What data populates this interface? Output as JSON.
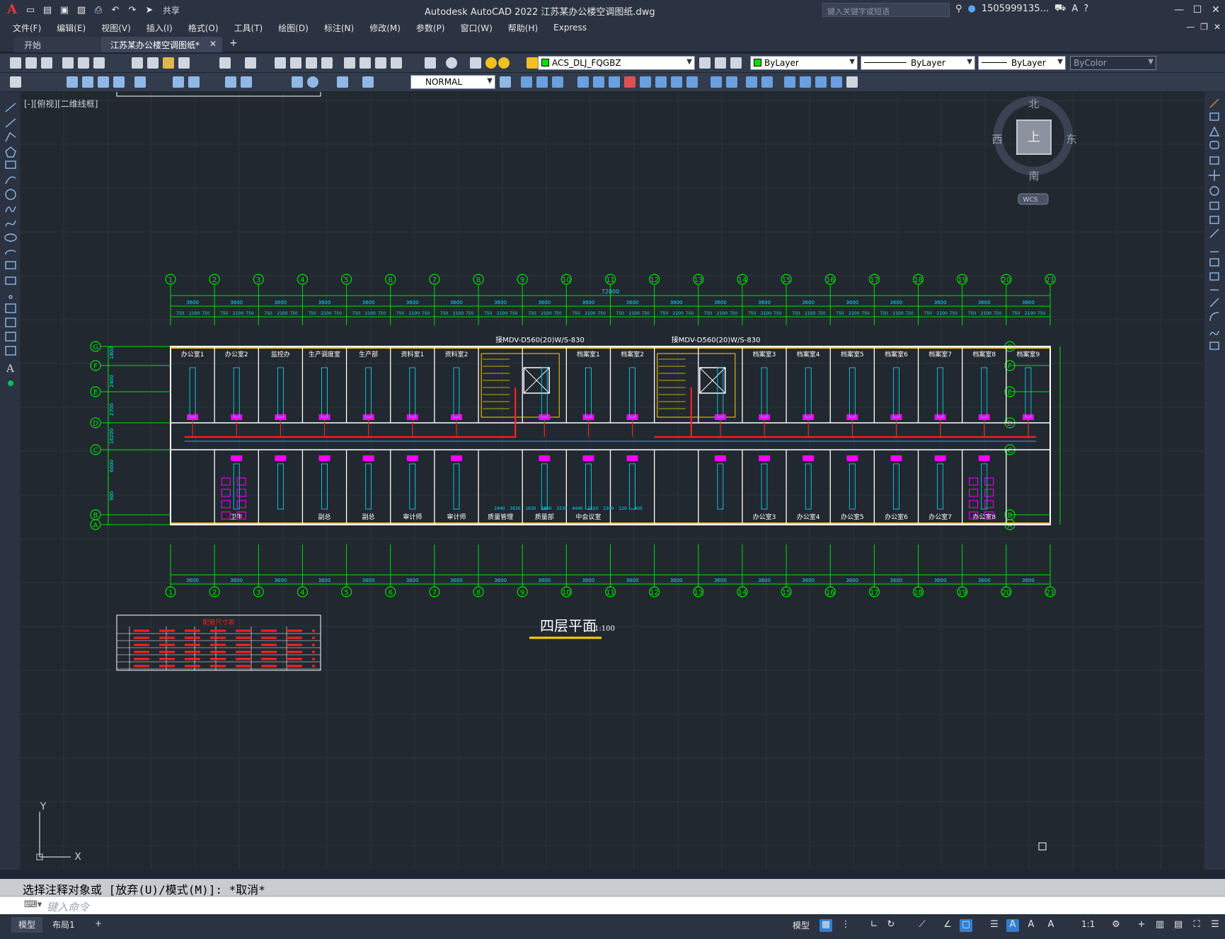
{
  "app": {
    "title": "Autodesk AutoCAD 2022    江苏某办公楼空调图纸.dwg",
    "share_label": "共享",
    "search_placeholder": "键入关键字或短语",
    "user": "1505999135...",
    "window_buttons": [
      "—",
      "☐",
      "✕"
    ]
  },
  "menu": [
    "文件(F)",
    "编辑(E)",
    "视图(V)",
    "插入(I)",
    "格式(O)",
    "工具(T)",
    "绘图(D)",
    "标注(N)",
    "修改(M)",
    "参数(P)",
    "窗口(W)",
    "帮助(H)",
    "Express"
  ],
  "tabs": {
    "start": "开始",
    "active": "江苏某办公楼空调图纸*",
    "close": "✕",
    "add": "+"
  },
  "toolbar": {
    "layer": "ACS_DLJ_FQGBZ",
    "color": "ByLayer",
    "linetype": "ByLayer",
    "lineweight": "ByLayer",
    "plotstyle": "ByColor",
    "dimstyle": "NORMAL"
  },
  "viewport_label": "[-][俯视][二维线框]",
  "viewcube": {
    "north": "北",
    "south": "南",
    "east": "东",
    "west": "西",
    "face": "上",
    "wcs": "WCS"
  },
  "ucs": {
    "x": "X",
    "y": "Y"
  },
  "drawing": {
    "title": "四层平面",
    "scale": "1:100",
    "total_dim": "72000",
    "table_title": "配管尺寸表",
    "axes_top": [
      "1",
      "2",
      "3",
      "4",
      "5",
      "6",
      "7",
      "8",
      "9",
      "10",
      "11",
      "12",
      "13",
      "14",
      "15",
      "16",
      "17",
      "18",
      "19",
      "20",
      "21"
    ],
    "axes_left": [
      "G",
      "F",
      "E",
      "D",
      "C",
      "B",
      "A"
    ],
    "bay_dims": [
      "3600",
      "3600",
      "3600",
      "3600",
      "3600",
      "3600",
      "3600",
      "3600",
      "3600",
      "3600",
      "3600",
      "3600",
      "3600",
      "3600",
      "3600",
      "3600",
      "3600",
      "3600",
      "3600",
      "3600"
    ],
    "sub_dims": [
      "750",
      "2100",
      "750",
      "750",
      "2100",
      "750",
      "750",
      "2100",
      "750",
      "750",
      "2100",
      "750"
    ],
    "left_dims": [
      "1800",
      "2400",
      "2700",
      "16200",
      "6000",
      "900"
    ],
    "annotations": [
      "接MDV-D560(20)W/S-830",
      "接MDV-D560(20)W/S-830"
    ],
    "rooms_top": [
      "办公室1",
      "办公室2",
      "监控办",
      "生产调度室",
      "生产部",
      "资料室1",
      "资料室2",
      "档案室1",
      "档案室2",
      "档案室3",
      "档案室4",
      "档案室5",
      "档案室6",
      "档案室7",
      "档案室8",
      "档案室9"
    ],
    "rooms_bottom": [
      "卫生",
      "副总",
      "副总",
      "审计师",
      "审计师",
      "质量管理",
      "质量部",
      "中会议室",
      "办公室3",
      "办公室4",
      "办公室5",
      "办公室6",
      "办公室7",
      "办公室8"
    ],
    "misc_dims": [
      "2440",
      "1630",
      "1630",
      "1800",
      "3330",
      "4440",
      "1320",
      "2340",
      "120",
      "400"
    ]
  },
  "command": {
    "history": "选择注释对象或 [放弃(U)/模式(M)]: *取消*",
    "placeholder": "键入命令"
  },
  "status": {
    "layout_model": "模型",
    "layout_1": "布局1",
    "layout_add": "+",
    "model": "模型",
    "scale": "1:1"
  },
  "colors": {
    "canvas": "#212830",
    "grid_major": "#2d3540",
    "wall": "#ffffff",
    "axis": "#00e000",
    "duct": "#ff2020",
    "unit": "#ff00ff",
    "dim": "#00e000",
    "text_cyan": "#00e5ff",
    "title_yellow": "#ffd200"
  }
}
